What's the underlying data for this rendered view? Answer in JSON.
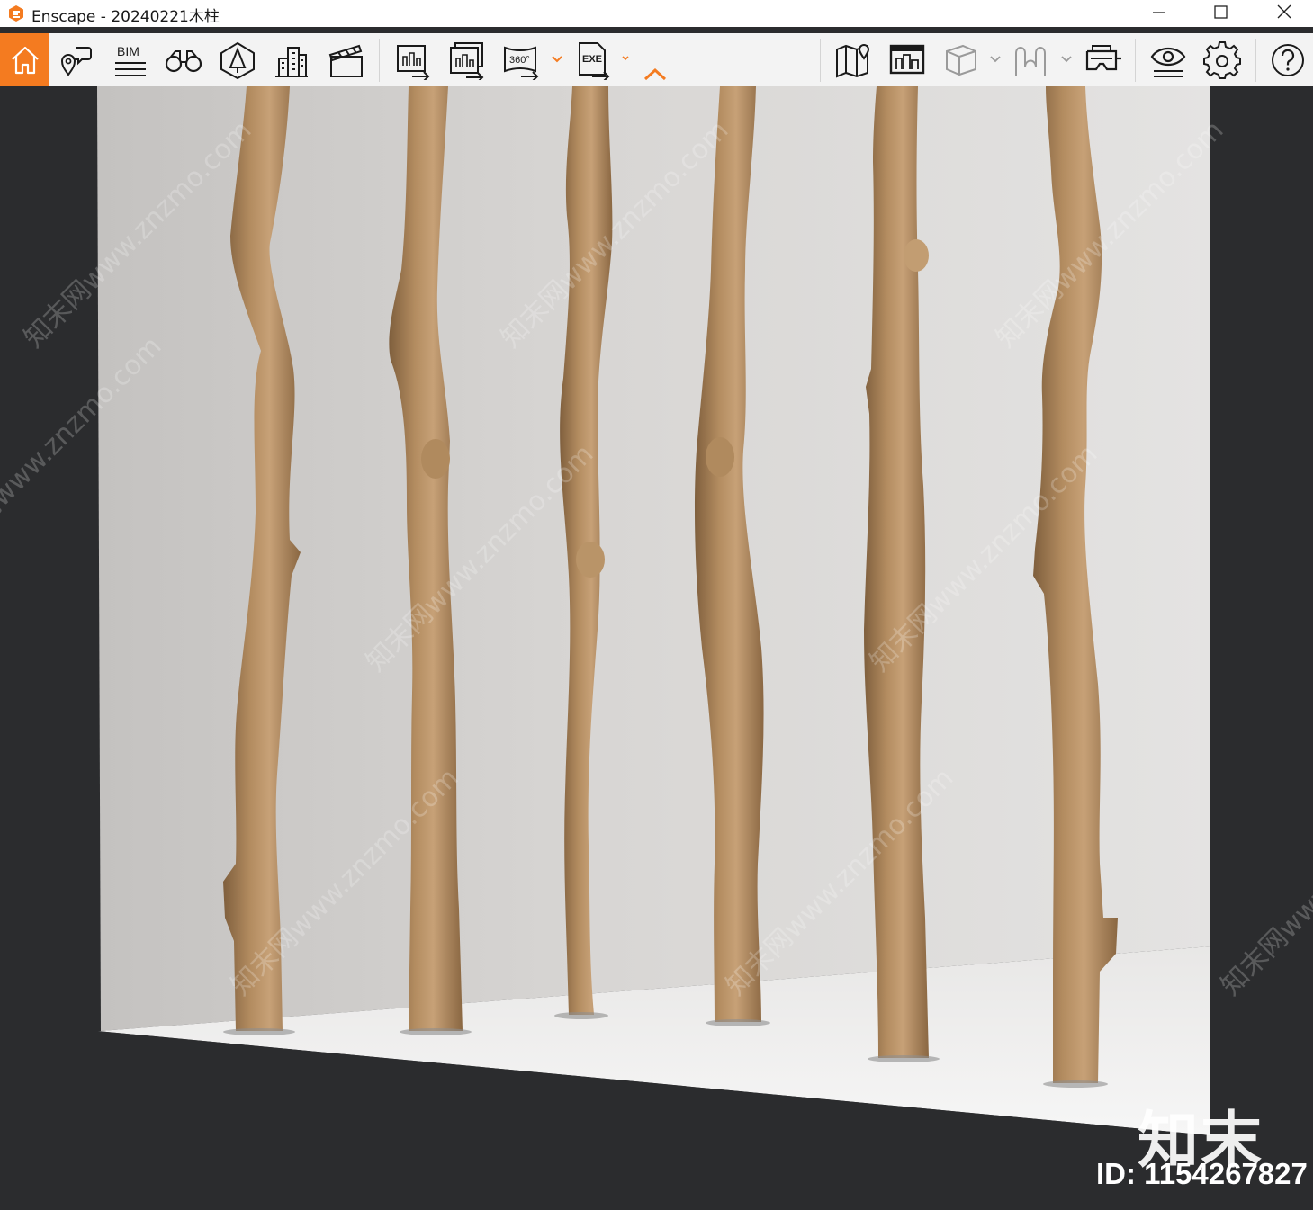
{
  "window": {
    "title": "Enscape - 20240221木柱"
  },
  "colors": {
    "accent": "#f47b20",
    "wall": "#d9d9d9",
    "floor": "#efefef",
    "wood": "#b08a5e",
    "background": "#2b2c2e"
  },
  "toolbar": {
    "left_buttons": [
      {
        "icon": "home-icon"
      },
      {
        "icon": "location-chat-icon"
      },
      {
        "icon": "bim-icon",
        "label": "BIM"
      },
      {
        "icon": "binoculars-icon"
      },
      {
        "icon": "perspective-tree-icon"
      },
      {
        "icon": "buildings-icon"
      },
      {
        "icon": "clapperboard-icon"
      }
    ],
    "export_buttons": [
      {
        "icon": "render-screenshot-icon"
      },
      {
        "icon": "batch-render-icon"
      },
      {
        "icon": "panorama-360-icon",
        "label": "360°"
      },
      {
        "icon": "export-exe-icon",
        "label": "EXE"
      }
    ],
    "right_buttons": [
      {
        "icon": "map-icon"
      },
      {
        "icon": "asset-library-icon"
      },
      {
        "icon": "cube-icon"
      },
      {
        "icon": "material-icon"
      },
      {
        "icon": "vr-headset-icon"
      },
      {
        "icon": "visual-settings-icon"
      },
      {
        "icon": "settings-gear-icon"
      },
      {
        "icon": "help-icon"
      }
    ]
  },
  "viewport": {
    "brand_mark": "知末",
    "image_id": "ID: 1154267827",
    "watermark": "知末网www.znzmo.com"
  }
}
